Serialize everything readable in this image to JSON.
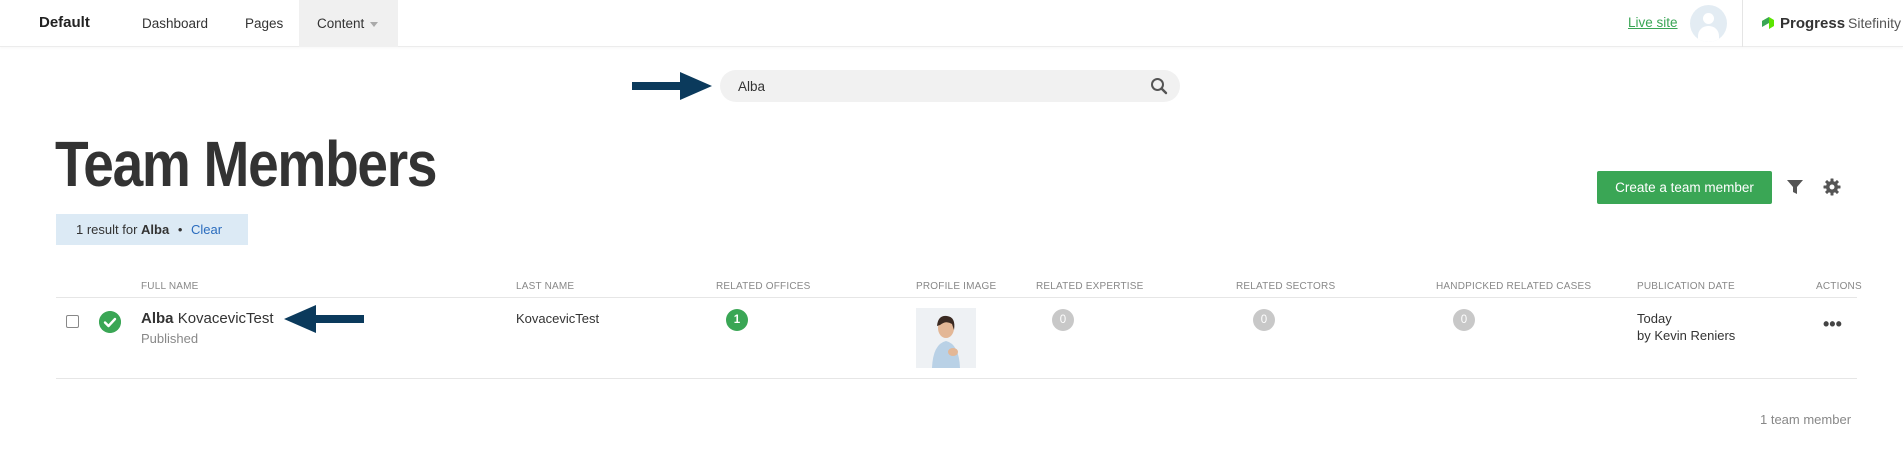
{
  "topbar": {
    "site_name": "Default",
    "nav": [
      "Dashboard",
      "Pages",
      "Content"
    ],
    "live_site": "Live site",
    "logo_primary": "Progress",
    "logo_secondary": "Sitefinity"
  },
  "search": {
    "value": "Alba"
  },
  "page": {
    "title": "Team Members",
    "result_prefix": "1 result for",
    "result_term": "Alba",
    "clear_label": "Clear",
    "create_button": "Create a team member",
    "footer_count": "1 team member"
  },
  "table": {
    "headers": [
      "Full name",
      "Last name",
      "Related offices",
      "Profile image",
      "Related expertise",
      "Related sectors",
      "Handpicked related cases",
      "Publication date",
      "Actions"
    ],
    "rows": [
      {
        "first_name": "Alba",
        "last_name_inline": "KovacevicTest",
        "status": "Published",
        "last_name": "KovacevicTest",
        "related_offices": "1",
        "related_expertise": "0",
        "related_sectors": "0",
        "handpicked_cases": "0",
        "pub_date": "Today",
        "pub_by": "by Kevin Reniers"
      }
    ]
  },
  "colors": {
    "accent_green": "#3aa655",
    "arrow_navy": "#0b3a5c",
    "info_bar": "#dceaf5"
  }
}
